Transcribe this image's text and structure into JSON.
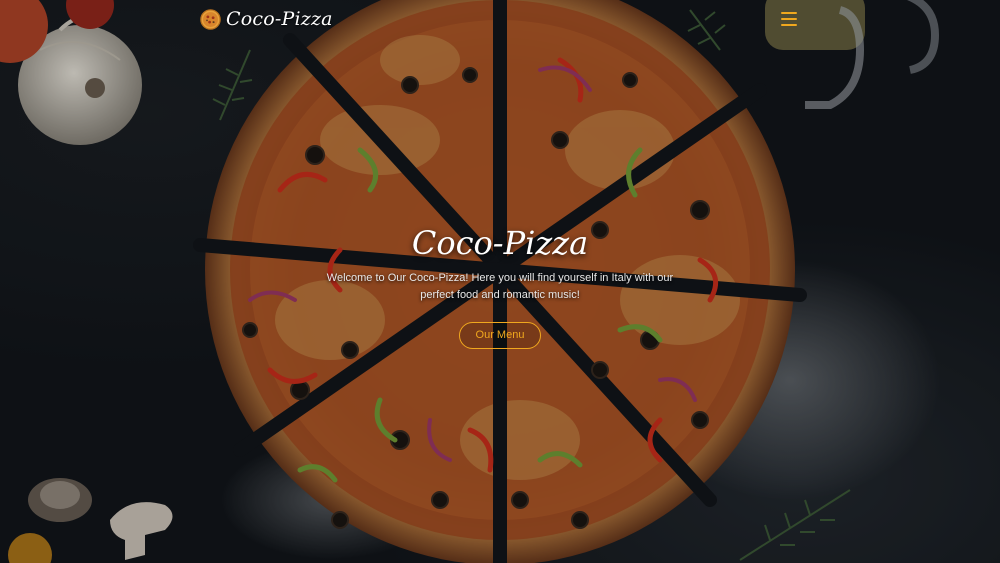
{
  "nav": {
    "brand_name": "Coco-Pizza",
    "logo_icon": "pizza-icon",
    "menu_icon": "hamburger-menu-icon"
  },
  "hero": {
    "title": "Coco-Pizza",
    "text": "Welcome to Our Coco-Pizza! Here you will find yourself in Italy with our perfect food and romantic music!",
    "button_label": "Our Menu"
  },
  "colors": {
    "accent": "#f0a81e",
    "background": "#12161b",
    "text": "#ffffff"
  }
}
